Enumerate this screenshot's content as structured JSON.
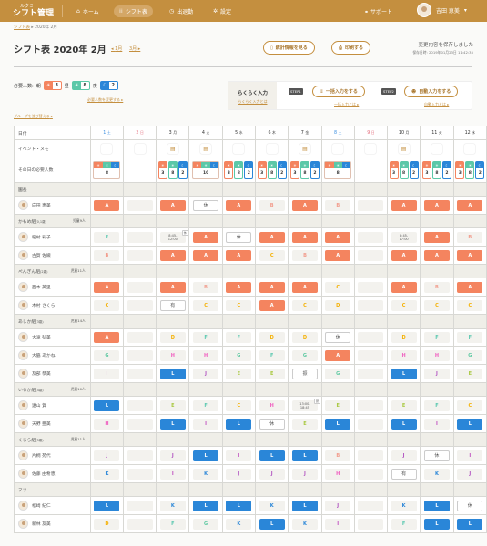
{
  "header": {
    "logo_small": "ルクミー",
    "logo": "シフト管理",
    "nav": [
      {
        "label": "ホーム",
        "icon": "home-icon",
        "active": false
      },
      {
        "label": "シフト表",
        "icon": "grid-icon",
        "active": true
      },
      {
        "label": "出退勤",
        "icon": "clock-icon",
        "active": false
      },
      {
        "label": "設定",
        "icon": "gear-icon",
        "active": false
      }
    ],
    "support": "サポート",
    "user": "吉田 恵美"
  },
  "breadcrumb": {
    "link": "シフト表",
    "current": "2020年 2月"
  },
  "title": "シフト表 2020年 2月",
  "prev_month": "1月",
  "next_month": "3月",
  "buttons": {
    "stats": "統計情報を見る",
    "print": "印刷する"
  },
  "save_status": {
    "message": "変更内容を保存しました",
    "date": "保存日時: 2019年01月23日 11:42:35"
  },
  "required": {
    "label": "必要人数:",
    "morning_label": "朝",
    "morning": "3",
    "day_label": "昼",
    "day": "8",
    "night_label": "夜",
    "night": "2",
    "change_link": "必要人数を変更する"
  },
  "colors": {
    "accent": "#c48f3f",
    "morning": "#f4845f",
    "day": "#5bc8a8",
    "night": "#2a86d8"
  },
  "raku": {
    "title": "らくらく入力",
    "about": "らくらく入力とは",
    "step1": "STEP1",
    "bulk": "一括入力をする",
    "bulk_about": "一括入力とは",
    "step2": "STEP2",
    "auto": "自動入力をする",
    "auto_about": "自動入力とは"
  },
  "group_link": "グループを並び替える",
  "table": {
    "date_label": "日付",
    "event_label": "イベント・メモ",
    "req_label": "その日の必要人数",
    "days": [
      {
        "d": "1",
        "w": "土",
        "c": "sat"
      },
      {
        "d": "2",
        "w": "日",
        "c": "sun"
      },
      {
        "d": "3",
        "w": "月"
      },
      {
        "d": "4",
        "w": "火"
      },
      {
        "d": "5",
        "w": "水"
      },
      {
        "d": "6",
        "w": "木"
      },
      {
        "d": "7",
        "w": "金"
      },
      {
        "d": "8",
        "w": "土",
        "c": "sat"
      },
      {
        "d": "9",
        "w": "日",
        "c": "sun"
      },
      {
        "d": "10",
        "w": "月"
      },
      {
        "d": "11",
        "w": "火"
      },
      {
        "d": "12",
        "w": "水"
      }
    ],
    "events": [
      "box",
      "box",
      "cal",
      "cal",
      "box",
      "box",
      "cal",
      "box",
      "box",
      "cal",
      "box",
      "box"
    ],
    "req": [
      [
        "8"
      ],
      [],
      [
        "3",
        "8",
        "2"
      ],
      [
        "10"
      ],
      [
        "3",
        "8",
        "2"
      ],
      [
        "3",
        "8",
        "2"
      ],
      [
        "3",
        "8",
        "2"
      ],
      [
        "8"
      ],
      [],
      [
        "3",
        "8",
        "2"
      ],
      [
        "3",
        "8",
        "2"
      ],
      [
        "3",
        "8",
        "2"
      ]
    ],
    "groups": [
      {
        "name": "園長",
        "count": "",
        "members": [
          {
            "name": "向田 恵美",
            "shifts": [
              "A",
              "",
              "A",
              "休",
              "A",
              "B",
              "A",
              "B",
              "",
              "A",
              "A",
              "A"
            ]
          }
        ]
      },
      {
        "name": "かもめ組",
        "age": "(0,1歳)",
        "count": "児童9人",
        "members": [
          {
            "name": "稲村 彩子",
            "shifts": [
              "F",
              "",
              "8:45-|12:00|休",
              "A",
              "休",
              "A",
              "A",
              "A",
              "",
              "8:45-|17:00",
              "A",
              "B"
            ]
          },
          {
            "name": "古賀 佐織",
            "shifts": [
              "B",
              "",
              "A",
              "A",
              "A",
              "C",
              "B",
              "A",
              "",
              "A",
              "A",
              "A"
            ]
          }
        ]
      },
      {
        "name": "ぺんぎん組",
        "age": "(2歳)",
        "count": "児童11人",
        "members": [
          {
            "name": "西本 英里",
            "shifts": [
              "A",
              "",
              "A",
              "B",
              "A",
              "A",
              "A",
              "C",
              "",
              "A",
              "B",
              "A"
            ]
          },
          {
            "name": "木村 さくら",
            "shifts": [
              "C",
              "",
              "有",
              "C",
              "C",
              "A",
              "C",
              "D",
              "",
              "C",
              "C",
              "C"
            ]
          }
        ]
      },
      {
        "name": "あしか組",
        "age": "(3歳)",
        "count": "児童14人",
        "members": [
          {
            "name": "大滝 弘美",
            "shifts": [
              "A",
              "",
              "D",
              "F",
              "F",
              "D",
              "D",
              "休",
              "",
              "D",
              "F",
              "F"
            ]
          },
          {
            "name": "大脇 あかね",
            "shifts": [
              "G",
              "",
              "H",
              "H",
              "G",
              "F",
              "G",
              "A",
              "",
              "H",
              "H",
              "G"
            ]
          },
          {
            "name": "及部 恭美",
            "shifts": [
              "I",
              "",
              "L",
              "J",
              "E",
              "E",
              "振",
              "G",
              "",
              "L",
              "J",
              "E"
            ]
          }
        ]
      },
      {
        "name": "いるか組",
        "age": "(4歳)",
        "count": "児童10人",
        "members": [
          {
            "name": "遠山 賀",
            "shifts": [
              "L",
              "",
              "E",
              "F",
              "C",
              "H",
              "13:00-|18:45|研",
              "E",
              "",
              "E",
              "F",
              "C"
            ]
          },
          {
            "name": "天野 亜美",
            "shifts": [
              "H",
              "",
              "L",
              "I",
              "L",
              "休",
              "E",
              "L",
              "",
              "L",
              "I",
              "L"
            ]
          }
        ]
      },
      {
        "name": "くじら組",
        "age": "(5歳)",
        "count": "児童11人",
        "members": [
          {
            "name": "片桐 苑代",
            "shifts": [
              "J",
              "",
              "J",
              "L",
              "I",
              "L",
              "L",
              "B",
              "",
              "J",
              "休",
              "I"
            ]
          },
          {
            "name": "佐藤 由希恵",
            "shifts": [
              "K",
              "",
              "I",
              "K",
              "J",
              "J",
              "J",
              "H",
              "",
              "有",
              "K",
              "J"
            ]
          }
        ]
      },
      {
        "name": "フリー",
        "count": "",
        "members": [
          {
            "name": "松崎 紀仁",
            "shifts": [
              "L",
              "",
              "K",
              "L",
              "L",
              "K",
              "L",
              "J",
              "",
              "K",
              "L",
              "休"
            ]
          },
          {
            "name": "新林 友美",
            "shifts": [
              "D",
              "",
              "F",
              "G",
              "K",
              "L",
              "K",
              "I",
              "",
              "F",
              "L",
              "L"
            ]
          }
        ]
      }
    ],
    "shift_colors": {
      "B": "#f29a8a",
      "C": "#f5b000",
      "D": "#f5b000",
      "E": "#a8c840",
      "F": "#5bc8b0",
      "G": "#5bc8a0",
      "H": "#f060c0",
      "I": "#c050c0",
      "J": "#b050c0",
      "K": "#2a86d8"
    }
  }
}
